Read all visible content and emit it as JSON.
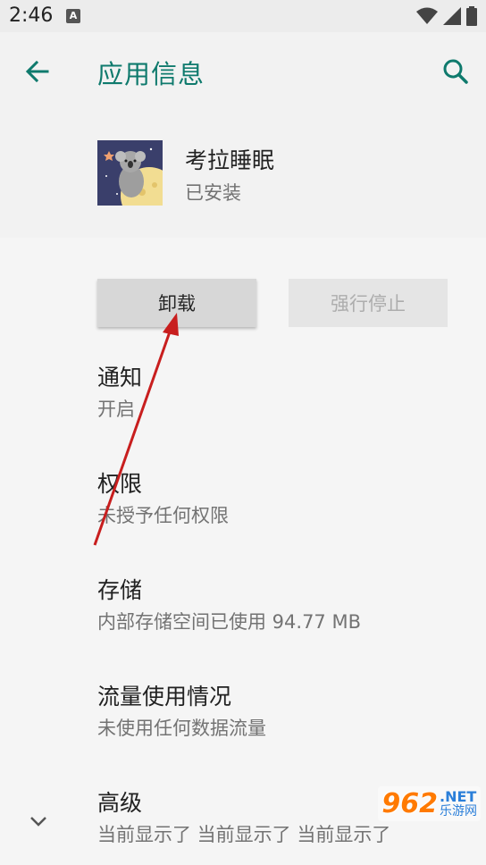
{
  "status_bar": {
    "time": "2:46",
    "notif_badge": "A",
    "icons": [
      "wifi-icon",
      "cell-signal-icon",
      "battery-icon"
    ]
  },
  "app_bar": {
    "title": "应用信息",
    "back_icon": "arrow-back-icon",
    "search_icon": "search-icon",
    "accent_color": "#0f7a6d"
  },
  "app": {
    "name": "考拉睡眠",
    "status": "已安装"
  },
  "actions": {
    "uninstall_label": "卸载",
    "force_stop_label": "强行停止"
  },
  "settings": [
    {
      "title": "通知",
      "subtitle": "开启"
    },
    {
      "title": "权限",
      "subtitle": "未授予任何权限"
    },
    {
      "title": "存储",
      "subtitle": "内部存储空间已使用 94.77 MB"
    },
    {
      "title": "流量使用情况",
      "subtitle": "未使用任何数据流量"
    },
    {
      "title": "高级",
      "subtitle": "当前显示了 当前显示了 当前显示了"
    }
  ],
  "watermark": {
    "number": "962",
    "domain": ".NET",
    "cn_text": "乐游网"
  }
}
